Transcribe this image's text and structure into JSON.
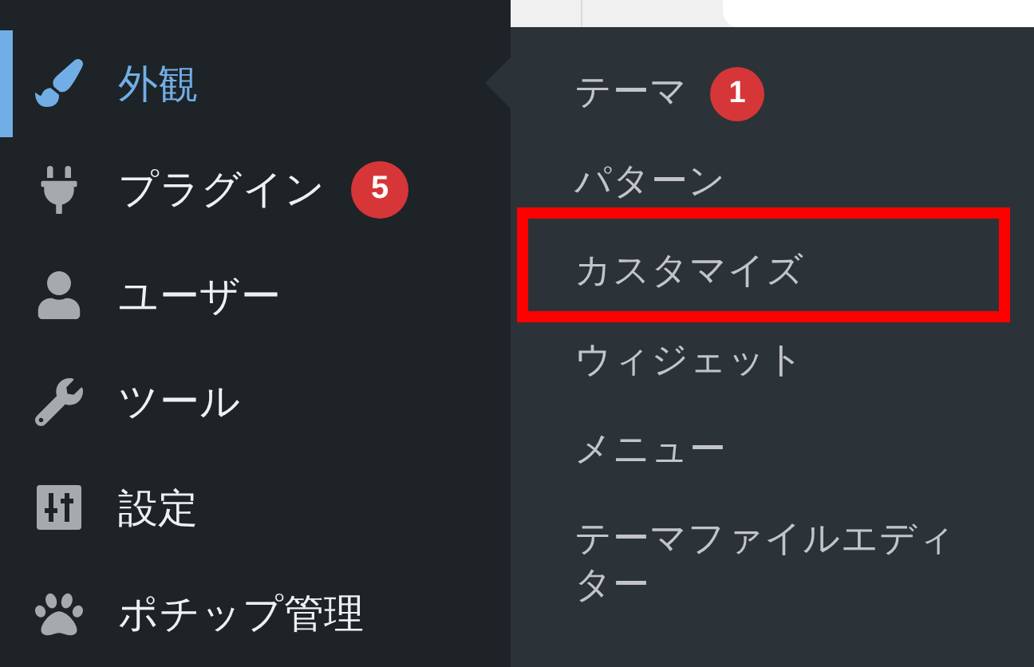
{
  "sidebar": {
    "items": [
      {
        "label": "外観",
        "selected": true
      },
      {
        "label": "プラグイン",
        "selected": false,
        "badge": "5"
      },
      {
        "label": "ユーザー",
        "selected": false
      },
      {
        "label": "ツール",
        "selected": false
      },
      {
        "label": "設定",
        "selected": false
      },
      {
        "label": "ポチップ管理",
        "selected": false
      }
    ]
  },
  "submenu": {
    "items": [
      {
        "label": "テーマ",
        "badge": "1",
        "highlighted": false
      },
      {
        "label": "パターン",
        "highlighted": false
      },
      {
        "label": "カスタマイズ",
        "highlighted": true
      },
      {
        "label": "ウィジェット",
        "highlighted": false
      },
      {
        "label": "メニュー",
        "highlighted": false
      },
      {
        "label": "テーマファイルエディター",
        "highlighted": false
      }
    ]
  }
}
